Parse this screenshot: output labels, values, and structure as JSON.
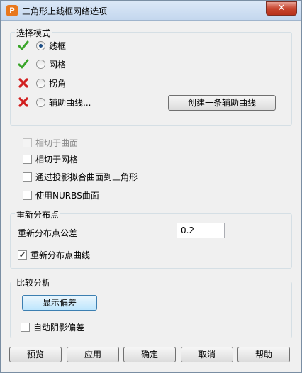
{
  "window": {
    "title": "三角形上线框网络选项",
    "app_icon_letter": "P",
    "close_glyph": "✕"
  },
  "mode_group": {
    "title": "选择模式",
    "options": [
      {
        "label": "线框",
        "selected": true,
        "status": "valid"
      },
      {
        "label": "网格",
        "selected": false,
        "status": "valid"
      },
      {
        "label": "拐角",
        "selected": false,
        "status": "invalid"
      },
      {
        "label": "辅助曲线...",
        "selected": false,
        "status": "invalid"
      }
    ],
    "create_aux_button": "创建一条辅助曲线"
  },
  "checkboxes": [
    {
      "label": "相切于曲面",
      "checked": false,
      "disabled": true
    },
    {
      "label": "相切于网格",
      "checked": false,
      "disabled": false
    },
    {
      "label": "通过投影拟合曲面到三角形",
      "checked": false,
      "disabled": false
    },
    {
      "label": "使用NURBS曲面",
      "checked": false,
      "disabled": false
    }
  ],
  "redistribute_group": {
    "title": "重新分布点",
    "tolerance_label": "重新分布点公差",
    "tolerance_value": "0.2",
    "curve_checkbox": {
      "label": "重新分布点曲线",
      "checked": true
    }
  },
  "compare_group": {
    "title": "比较分析",
    "show_deviation_button": "显示偏差",
    "auto_shade_checkbox": {
      "label": "自动阴影偏差",
      "checked": false
    }
  },
  "footer": {
    "buttons": [
      "预览",
      "应用",
      "确定",
      "取消",
      "帮助"
    ]
  },
  "colors": {
    "valid_check": "#3aa52a",
    "invalid_cross": "#d11f1f"
  },
  "icons": {
    "valid": "green-check-icon",
    "invalid": "red-cross-icon"
  }
}
